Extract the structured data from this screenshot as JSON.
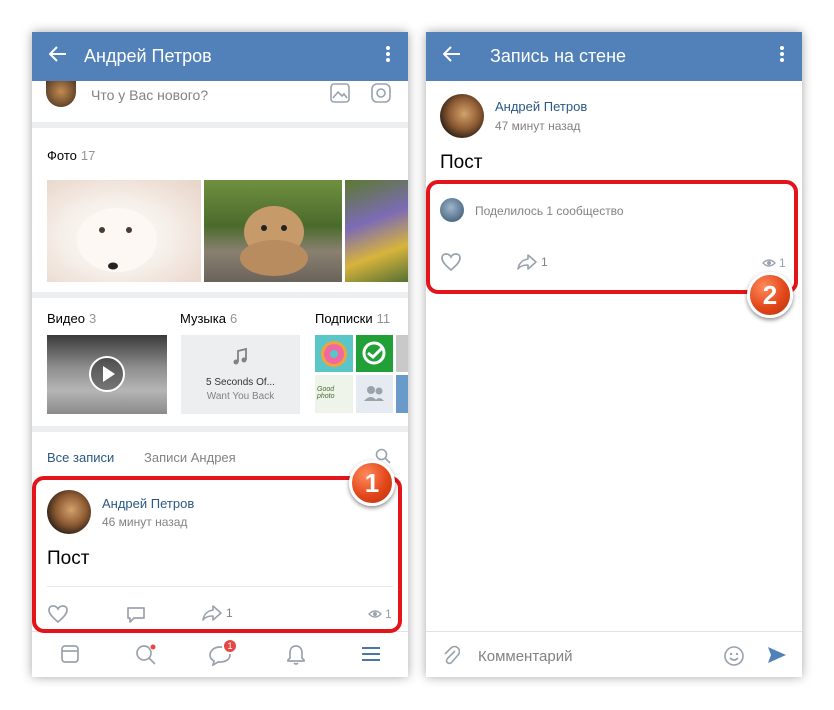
{
  "left": {
    "header": {
      "title": "Андрей Петров"
    },
    "composer": {
      "placeholder": "Что у Вас нового?"
    },
    "photos": {
      "label": "Фото",
      "count": "17"
    },
    "video": {
      "label": "Видео",
      "count": "3"
    },
    "music": {
      "label": "Музыка",
      "count": "6",
      "track_title": "5 Seconds Of...",
      "track_artist": "Want You Back"
    },
    "subscriptions": {
      "label": "Подписки",
      "count": "11",
      "good_photo": "Good photo"
    },
    "tabs": {
      "all": "Все записи",
      "own": "Записи Андрея"
    },
    "post": {
      "author": "Андрей Петров",
      "time": "46 минут назад",
      "text": "Пост",
      "shares": "1",
      "views": "1"
    },
    "nav": {
      "messages_badge": "1"
    },
    "marker": "1"
  },
  "right": {
    "header": {
      "title": "Запись на стене"
    },
    "post": {
      "author": "Андрей Петров",
      "time": "47 минут назад",
      "text": "Пост",
      "shared_text": "Поделилось 1 сообщество",
      "shares": "1",
      "views": "1"
    },
    "comment": {
      "placeholder": "Комментарий"
    },
    "marker": "2"
  },
  "colors": {
    "header": "#5181b8",
    "link": "#2a5885",
    "highlight": "#e3151b",
    "accent": "#4a76a8"
  }
}
